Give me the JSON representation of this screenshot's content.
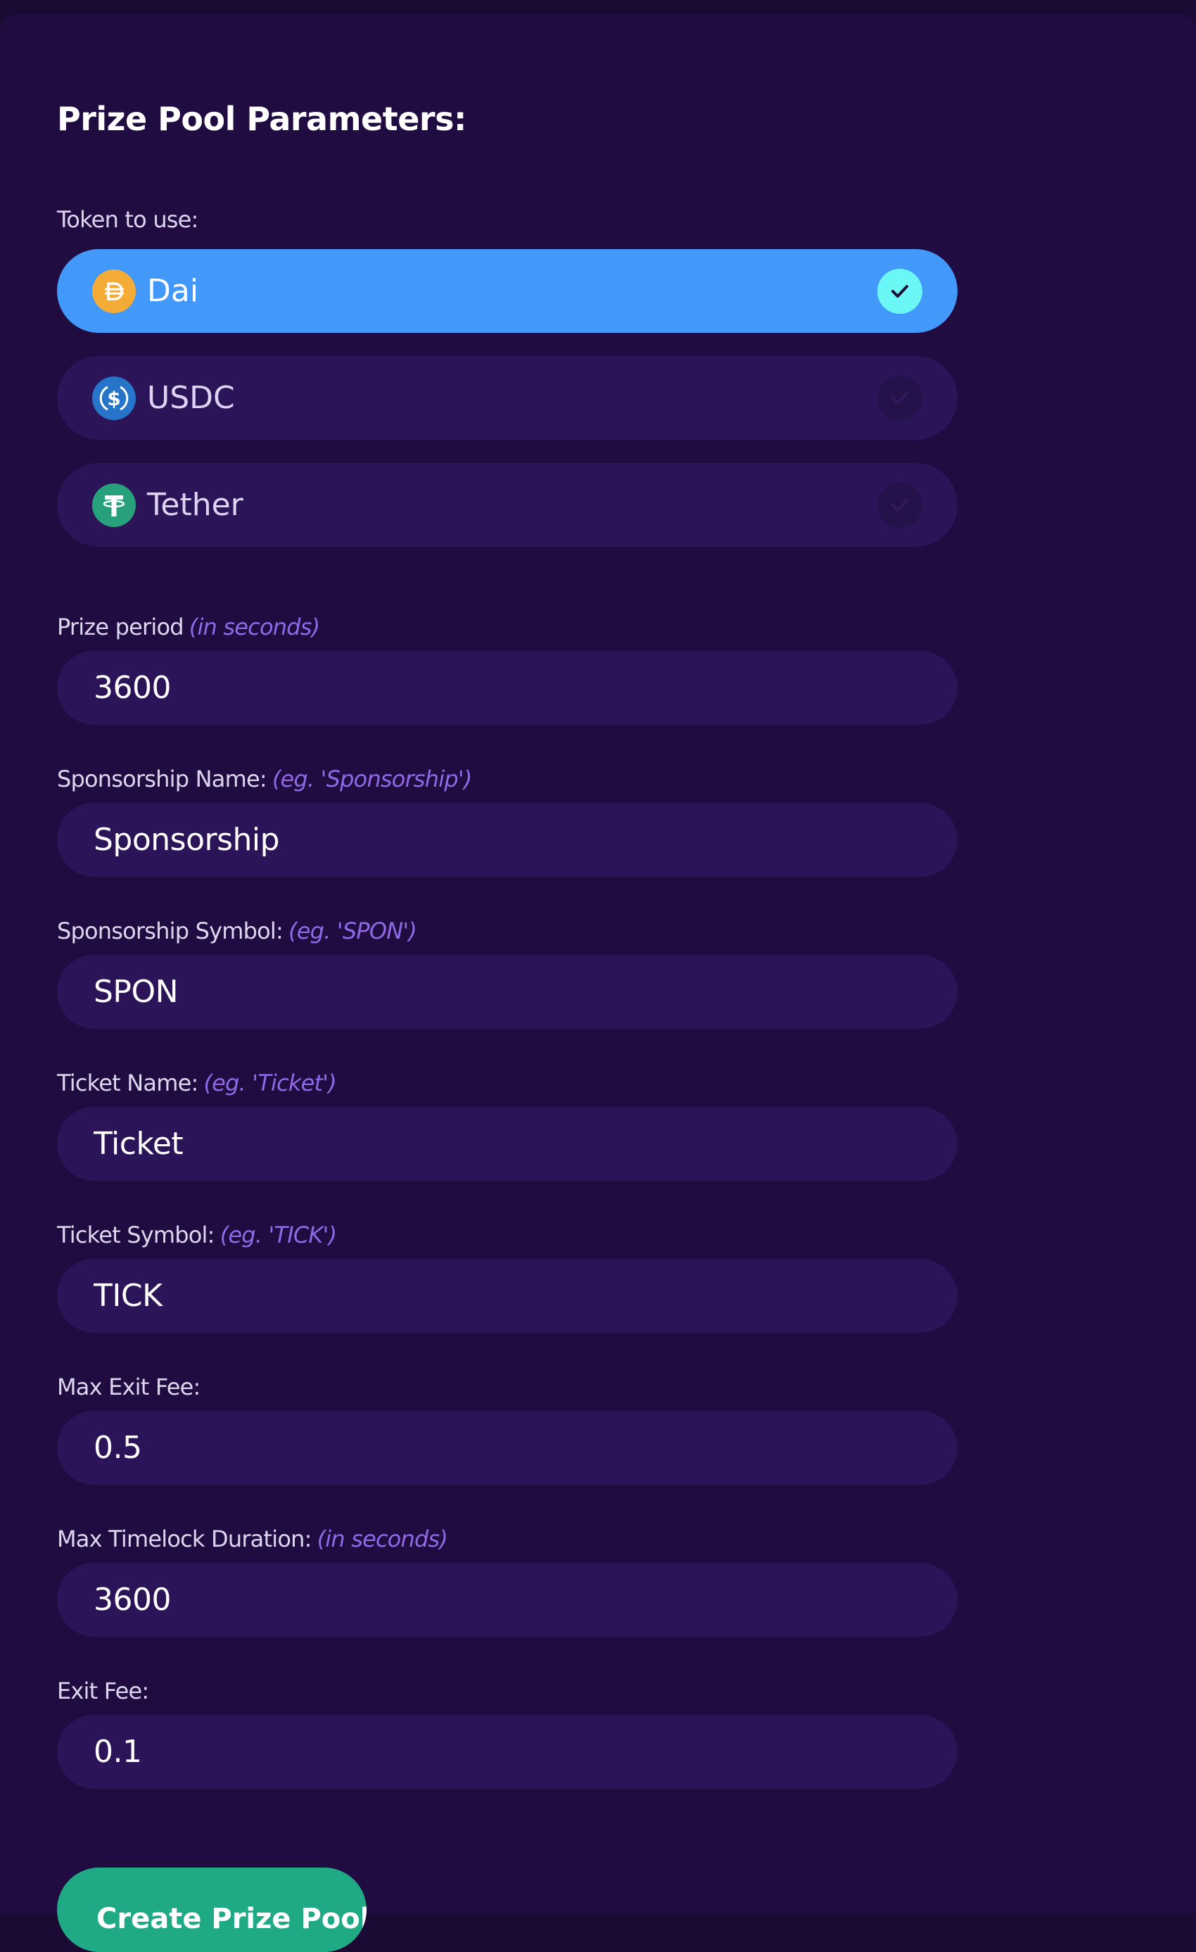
{
  "form": {
    "title": "Prize Pool Parameters:",
    "token_label": "Token to use:",
    "tokens": [
      {
        "label": "Dai",
        "icon": "dai-icon",
        "color": "#f5ac37",
        "selected": true
      },
      {
        "label": "USDC",
        "icon": "usdc-icon",
        "color": "#2775ca",
        "selected": false
      },
      {
        "label": "Tether",
        "icon": "tether-icon",
        "color": "#26a17b",
        "selected": false
      }
    ],
    "prize_period": {
      "label": "Prize period",
      "hint": "(in seconds)",
      "value": "3600"
    },
    "sponsorship_name": {
      "label": "Sponsorship Name:",
      "hint": "(eg. 'Sponsorship')",
      "value": "Sponsorship"
    },
    "sponsorship_symbol": {
      "label": "Sponsorship Symbol:",
      "hint": "(eg. 'SPON')",
      "value": "SPON"
    },
    "ticket_name": {
      "label": "Ticket Name:",
      "hint": "(eg. 'Ticket')",
      "value": "Ticket"
    },
    "ticket_symbol": {
      "label": "Ticket Symbol:",
      "hint": "(eg. 'TICK')",
      "value": "TICK"
    },
    "max_exit_fee": {
      "label": "Max Exit Fee:",
      "value": "0.5"
    },
    "max_timelock": {
      "label": "Max Timelock Duration:",
      "hint": "(in seconds)",
      "value": "3600"
    },
    "exit_fee": {
      "label": "Exit Fee:",
      "value": "0.1"
    },
    "submit_label": "Create Prize Pool"
  },
  "colors": {
    "page_bg": "#1b0b34",
    "card_bg": "#210c41",
    "field_bg": "#2c1458",
    "selected_bg": "#4399f9",
    "check_active": "#6cf7f7",
    "hint": "#8f69e6",
    "submit_bg": "#1faa85"
  }
}
